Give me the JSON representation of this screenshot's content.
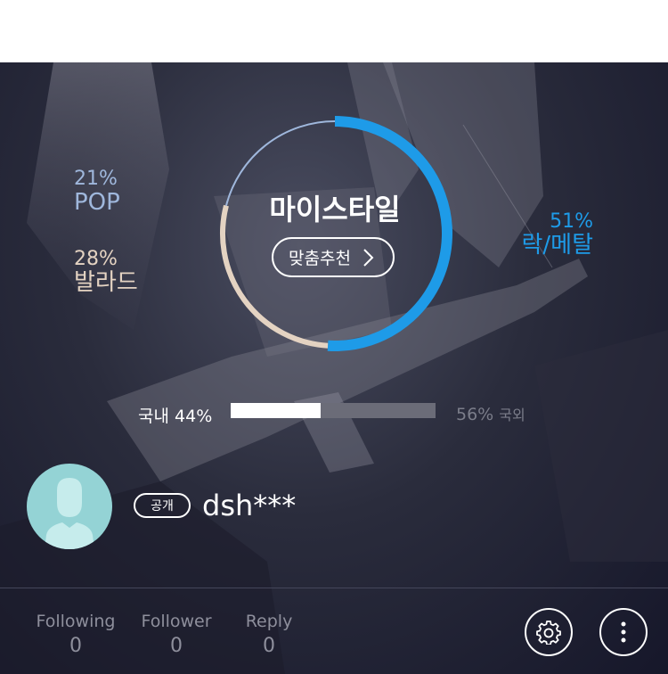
{
  "style": {
    "title": "마이스타일",
    "recommend_button": "맞춤추천",
    "genres": [
      {
        "percent": "21%",
        "name": "POP",
        "share": 21,
        "color": "#9fb7dc"
      },
      {
        "percent": "28%",
        "name": "발라드",
        "share": 28,
        "color": "#e4d3c2"
      },
      {
        "percent": "51%",
        "name": "락/메탈",
        "share": 51,
        "color": "#1e9be8"
      }
    ]
  },
  "domestic": {
    "label": "국내",
    "percent": "44%",
    "value": 44
  },
  "foreign": {
    "label": "국외",
    "percent": "56%",
    "value": 56
  },
  "profile": {
    "visibility_badge": "공개",
    "username": "dsh***",
    "avatar_icon": "person-icon"
  },
  "stats": {
    "following": {
      "label": "Following",
      "value": "0"
    },
    "follower": {
      "label": "Follower",
      "value": "0"
    },
    "reply": {
      "label": "Reply",
      "value": "0"
    }
  },
  "icons": {
    "settings": "gear-icon",
    "more": "more-vertical-icon"
  }
}
